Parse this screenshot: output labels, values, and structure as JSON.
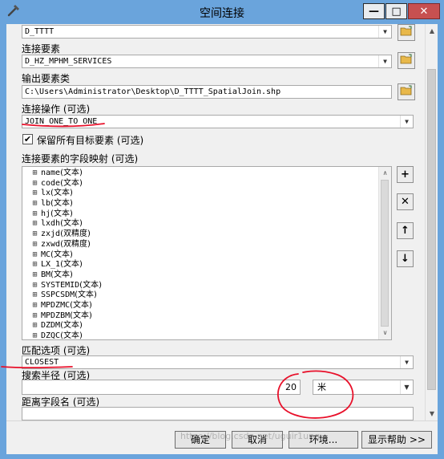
{
  "window": {
    "title": "空间连接",
    "controls": {
      "minimize": "—",
      "maximize": "□",
      "close": "✕"
    }
  },
  "form": {
    "target_features_value": "D_TTTT",
    "join_features_label": "连接要素",
    "join_features_value": "D_HZ_MPHM_SERVICES",
    "output_label": "输出要素类",
    "output_value": "C:\\Users\\Administrator\\Desktop\\D_TTTT_SpatialJoin.shp",
    "join_operation_label": "连接操作 (可选)",
    "join_operation_value": "JOIN_ONE_TO_ONE",
    "keep_all_label": "保留所有目标要素 (可选)",
    "keep_all_checked": "✔",
    "field_map_label": "连接要素的字段映射 (可选)",
    "field_map": [
      {
        "name": "name",
        "type": "(文本)"
      },
      {
        "name": "code",
        "type": "(文本)"
      },
      {
        "name": "lx",
        "type": "(文本)"
      },
      {
        "name": "lb",
        "type": "(文本)"
      },
      {
        "name": "hj",
        "type": "(文本)"
      },
      {
        "name": "lxdh",
        "type": "(文本)"
      },
      {
        "name": "zxjd",
        "type": "(双精度)"
      },
      {
        "name": "zxwd",
        "type": "(双精度)"
      },
      {
        "name": "MC",
        "type": "(文本)"
      },
      {
        "name": "LX_1",
        "type": "(文本)"
      },
      {
        "name": "BM",
        "type": "(文本)"
      },
      {
        "name": "SYSTEMID",
        "type": "(文本)"
      },
      {
        "name": "SSPCSDM",
        "type": "(文本)"
      },
      {
        "name": "MPDZMC",
        "type": "(文本)"
      },
      {
        "name": "MPDZBM",
        "type": "(文本)"
      },
      {
        "name": "DZDM",
        "type": "(文本)"
      },
      {
        "name": "DZQC",
        "type": "(文本)"
      }
    ],
    "match_option_label": "匹配选项 (可选)",
    "match_option_value": "CLOSEST",
    "search_radius_label": "搜索半径 (可选)",
    "search_radius_value": "20",
    "search_radius_unit": "米",
    "distance_field_label": "距离字段名 (可选)",
    "distance_field_value": ""
  },
  "buttons": {
    "ok": "确定",
    "cancel": "取消",
    "environments": "环境...",
    "show_help": "显示帮助 >>"
  },
  "side_buttons": {
    "add": "+",
    "remove": "✕",
    "up": "↑",
    "down": "↓"
  },
  "watermark": "https://blog.csdn.net/uguir1ung",
  "colors": {
    "title_bar": "#6aa4dc",
    "close_button": "#c75050",
    "annotation_red": "#e8102a",
    "folder_icon": "#e8b84a"
  }
}
